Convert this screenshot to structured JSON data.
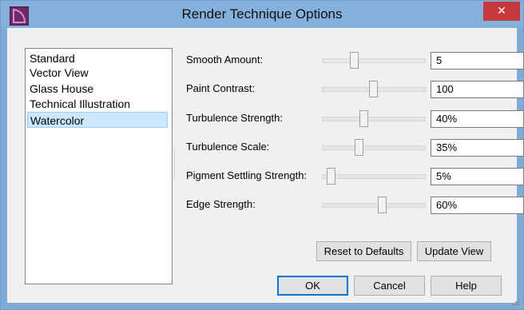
{
  "window": {
    "title": "Render Technique Options",
    "close_glyph": "✕",
    "app_icon": "chief-architect-app-icon"
  },
  "techniques": {
    "items": [
      "Standard",
      "Vector View",
      "Glass House",
      "Technical Illustration",
      "Watercolor"
    ],
    "selected": "Watercolor"
  },
  "options": [
    {
      "label": "Smooth Amount:",
      "value": "5",
      "slider_level": 0.3
    },
    {
      "label": "Paint Contrast:",
      "value": "100",
      "slider_level": 0.5
    },
    {
      "label": "Turbulence Strength:",
      "value": "40%",
      "slider_level": 0.4
    },
    {
      "label": "Turbulence Scale:",
      "value": "35%",
      "slider_level": 0.35
    },
    {
      "label": "Pigment Settling Strength:",
      "value": "5%",
      "slider_level": 0.05
    },
    {
      "label": "Edge Strength:",
      "value": "60%",
      "slider_level": 0.6
    }
  ],
  "buttons": {
    "reset": "Reset to Defaults",
    "update": "Update View",
    "ok": "OK",
    "cancel": "Cancel",
    "help": "Help"
  },
  "colors": {
    "titlebar": "#84b1dc",
    "close": "#c7383d",
    "selection": "#cce8ff"
  }
}
